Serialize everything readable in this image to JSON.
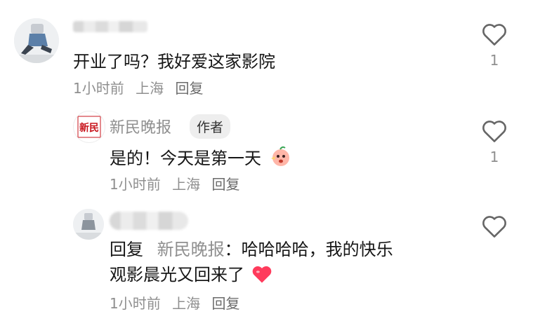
{
  "comments": [
    {
      "text": "开业了吗？我好爱这家影院",
      "time": "1小时前",
      "location": "上海",
      "reply_label": "回复",
      "like_count": "1"
    },
    {
      "author": "新民晚报",
      "author_tag": "作者",
      "logo_text": "新民",
      "text": "是的！今天是第一天",
      "time": "1小时前",
      "location": "上海",
      "reply_label": "回复",
      "like_count": "1"
    },
    {
      "reply_prefix": "回复",
      "reply_to": "新民晚报",
      "text_line1": "：哈哈哈哈，我的快乐",
      "text_line2": "观影晨光又回来了",
      "time": "1小时前",
      "location": "上海",
      "reply_label": "回复"
    }
  ],
  "colors": {
    "heart_outline": "#666666",
    "emoji_heart": "#ff3b5c",
    "logo_red": "#c8141c"
  }
}
